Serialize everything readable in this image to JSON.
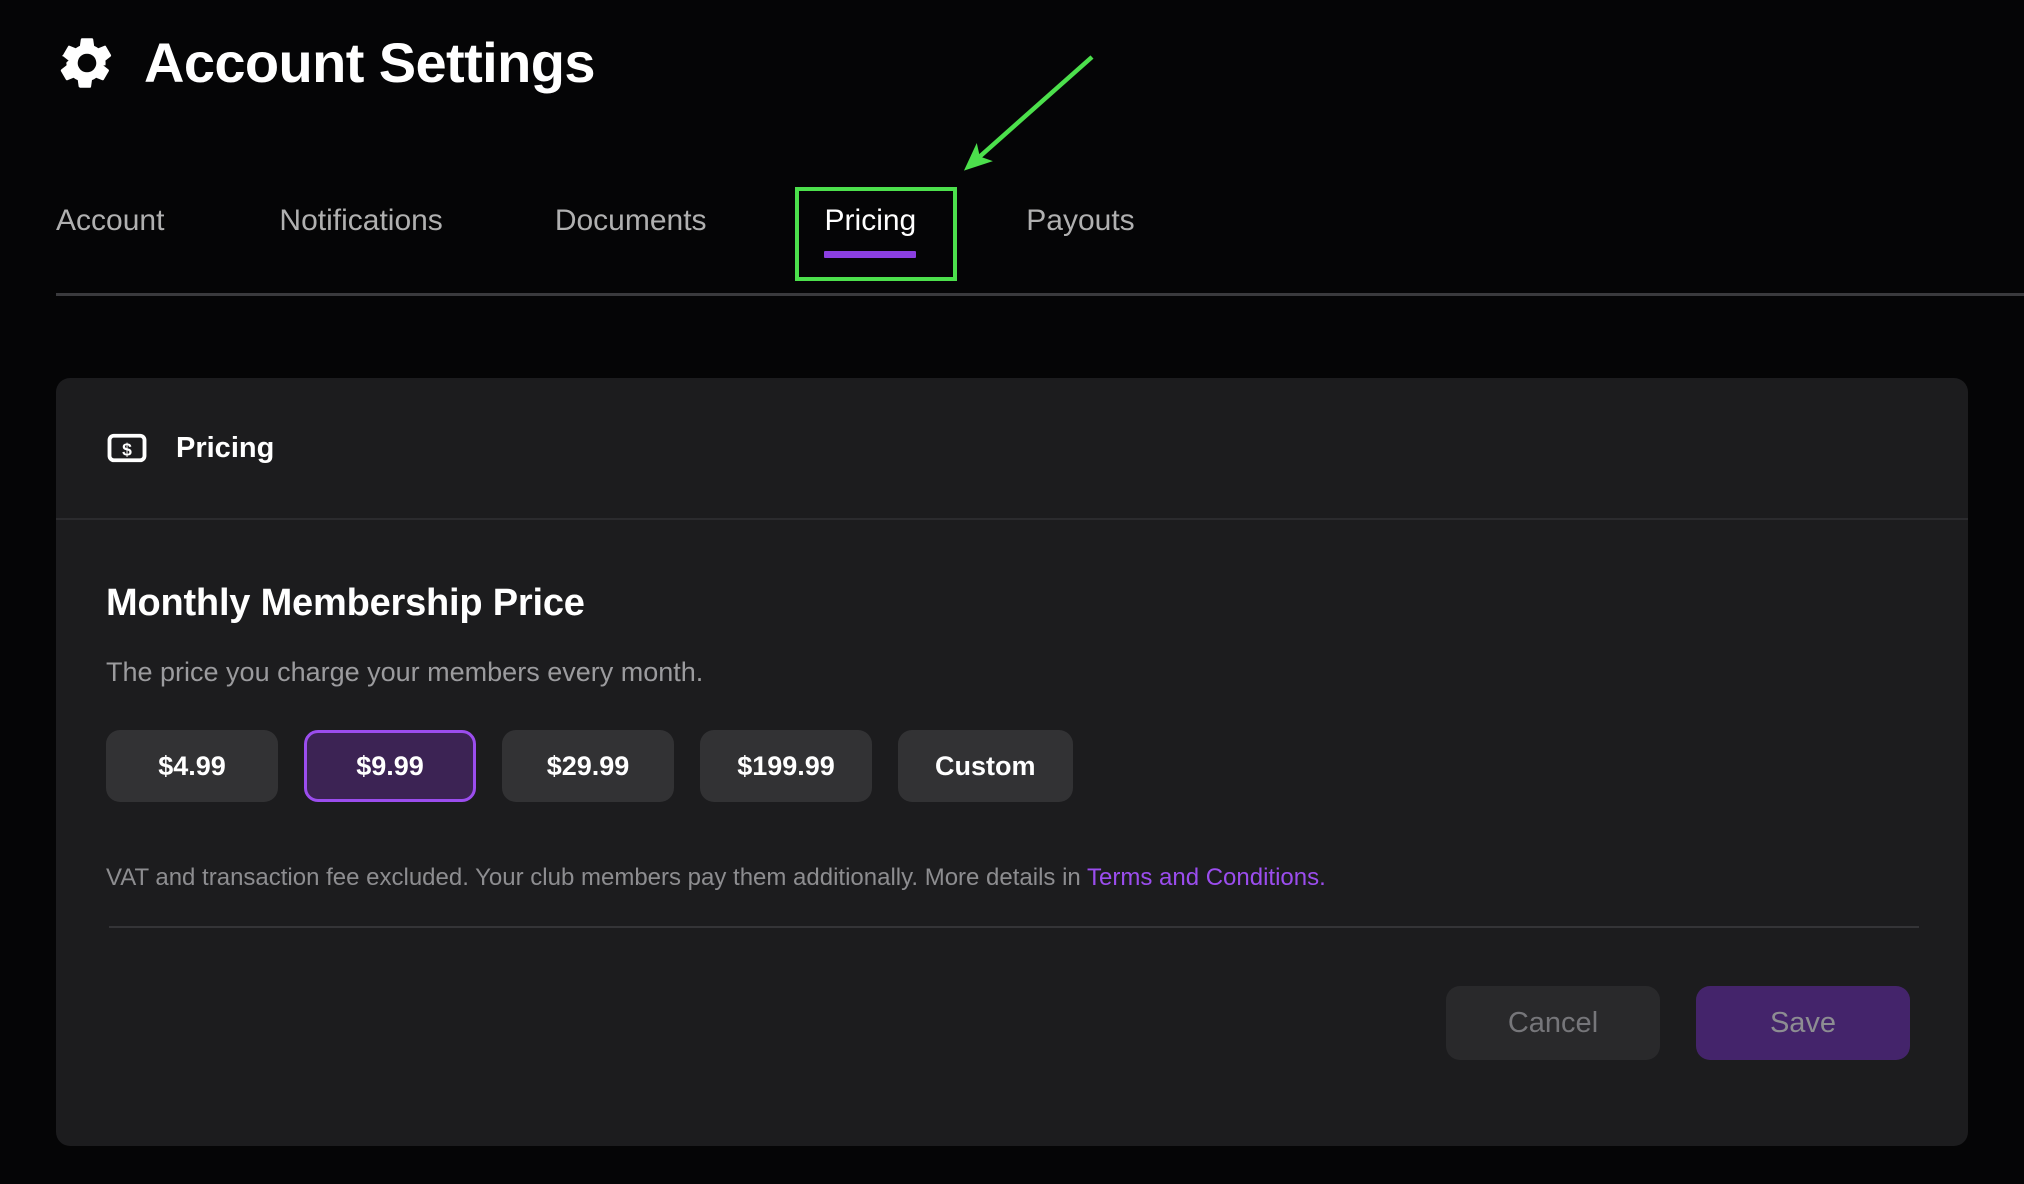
{
  "header": {
    "title": "Account Settings",
    "icon": "gear-icon"
  },
  "tabs": [
    {
      "label": "Account",
      "active": false
    },
    {
      "label": "Notifications",
      "active": false
    },
    {
      "label": "Documents",
      "active": false
    },
    {
      "label": "Pricing",
      "active": true
    },
    {
      "label": "Payouts",
      "active": false
    }
  ],
  "card": {
    "header": {
      "icon": "money-banknote-icon",
      "title": "Pricing"
    },
    "section": {
      "title": "Monthly Membership Price",
      "subtitle": "The price you charge your members every month."
    },
    "price_options": [
      {
        "label": "$4.99",
        "selected": false
      },
      {
        "label": "$9.99",
        "selected": true
      },
      {
        "label": "$29.99",
        "selected": false
      },
      {
        "label": "$199.99",
        "selected": false
      },
      {
        "label": "Custom",
        "selected": false
      }
    ],
    "fineprint": {
      "text": "VAT and transaction fee excluded. Your club members pay them additionally. More details in ",
      "link_text": "Terms and Conditions."
    },
    "footer": {
      "cancel_label": "Cancel",
      "save_label": "Save"
    }
  },
  "annotation": {
    "highlight_target": "Pricing",
    "color": "#4ce04c"
  },
  "colors": {
    "page_background": "#050506",
    "card_background": "#1c1c1e",
    "accent_purple": "#9b4dee",
    "active_tab_underline": "#8b3fe0",
    "selected_pill_fill": "#3c2354",
    "save_button_fill": "#44246b",
    "annotation_green": "#4ce04c"
  }
}
